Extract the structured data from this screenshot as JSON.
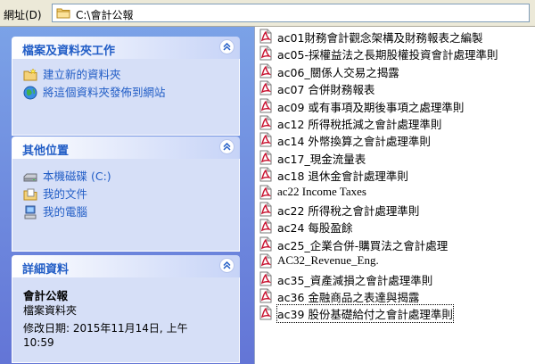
{
  "address": {
    "label": "網址(D)",
    "path": "C:\\會計公報"
  },
  "tasks_panel": {
    "title": "檔案及資料夾工作",
    "items": [
      {
        "label": "建立新的資料夾",
        "icon": "new-folder-icon"
      },
      {
        "label": "將這個資料夾發佈到網站",
        "icon": "publish-web-icon"
      }
    ]
  },
  "places_panel": {
    "title": "其他位置",
    "items": [
      {
        "label": "本機磁碟 (C:)",
        "icon": "local-disk-icon"
      },
      {
        "label": "我的文件",
        "icon": "my-documents-icon"
      },
      {
        "label": "我的電腦",
        "icon": "my-computer-icon"
      }
    ]
  },
  "details_panel": {
    "title": "詳細資料",
    "name": "會計公報",
    "type": "檔案資料夾",
    "modified_line1": "修改日期: 2015年11月14日, 上午",
    "modified_line2": "10:59"
  },
  "files": [
    "ac01財務會計觀念架構及財務報表之編製",
    "ac05-採權益法之長期股權投資會計處理準則",
    "ac06_關係人交易之揭露",
    "ac07 合併財務報表",
    "ac09 或有事項及期後事項之處理準則",
    "ac12 所得稅抵減之會計處理準則",
    "ac14 外幣換算之會計處理準則",
    "ac17_現金流量表",
    "ac18 退休金會計處理準則",
    "ac22 Income Taxes",
    "ac22 所得稅之會計處理準則",
    "ac24 每股盈餘",
    "ac25_企業合併-購買法之會計處理",
    "AC32_Revenue_Eng.",
    "ac35_資產減損之會計處理準則",
    "ac36 金融商品之表達與揭露",
    "ac39 股份基礎給付之會計處理準則"
  ],
  "colors": {
    "pane_gradient_top": "#7ba2e7",
    "pane_gradient_bottom": "#6375d6",
    "panel_title": "#215dc6",
    "panel_body": "#d6dff7",
    "pdf_icon_red": "#c8102e"
  }
}
